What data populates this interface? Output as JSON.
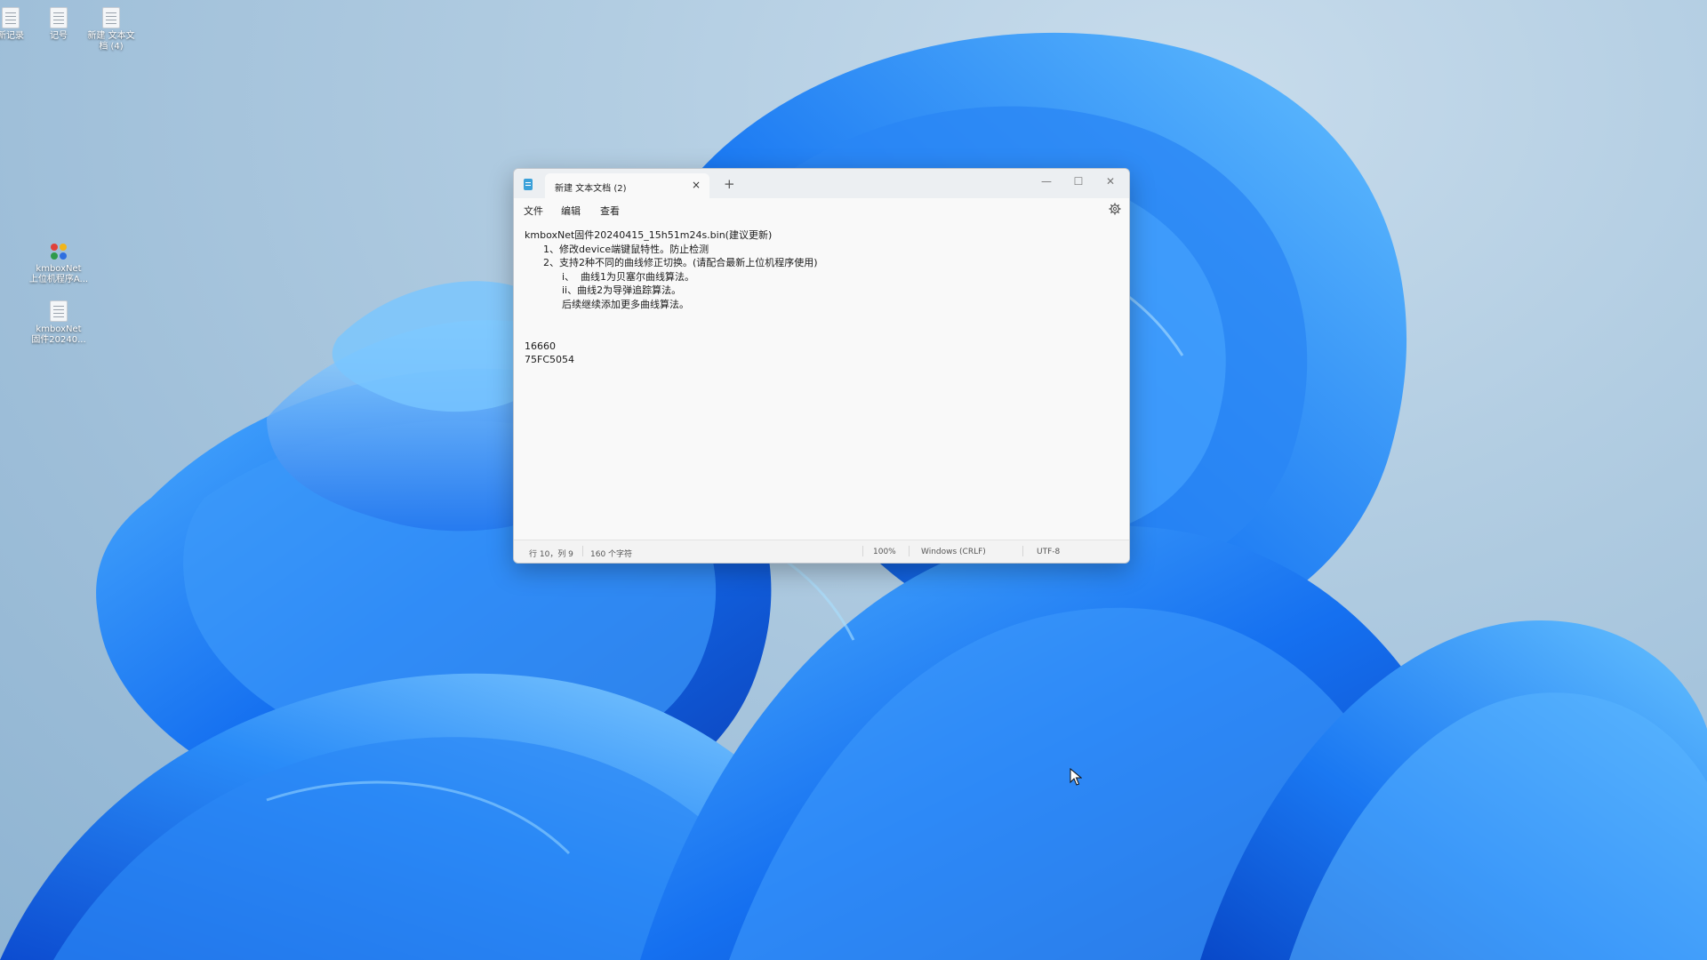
{
  "desktop": {
    "icons": [
      {
        "label": "新记录",
        "type": "file"
      },
      {
        "label": "记号",
        "type": "file"
      },
      {
        "label": "新建 文本文\n档 (4)",
        "type": "file"
      },
      {
        "label": "kmboxNet\n上位机程序A...",
        "type": "exe"
      },
      {
        "label": "kmboxNet\n固件20240...",
        "type": "file"
      }
    ]
  },
  "window": {
    "tab_title": "新建 文本文档 (2)",
    "tab_close": "×",
    "new_tab": "+",
    "caption": {
      "minimize": "—",
      "maximize": "☐",
      "close": "✕"
    },
    "menu": {
      "file": "文件",
      "edit": "编辑",
      "view": "查看"
    },
    "content_lines": [
      "kmboxNet固件20240415_15h51m24s.bin(建议更新)",
      "      1、修改device端键鼠特性。防止检测",
      "      2、支持2种不同的曲线修正切换。(请配合最新上位机程序使用)",
      "            i、  曲线1为贝塞尔曲线算法。",
      "            ii、曲线2为导弹追踪算法。",
      "            后续继续添加更多曲线算法。",
      "",
      "",
      "16660",
      "75FC5054"
    ],
    "status": {
      "position": "行 10，列 9",
      "chars": "160 个字符",
      "zoom": "100%",
      "line_ending": "Windows (CRLF)",
      "encoding": "UTF-8"
    }
  },
  "colors": {
    "accent": "#0a5fd8",
    "wallpaper_light": "#b2cde2",
    "window_bg": "#f9f9f9"
  }
}
